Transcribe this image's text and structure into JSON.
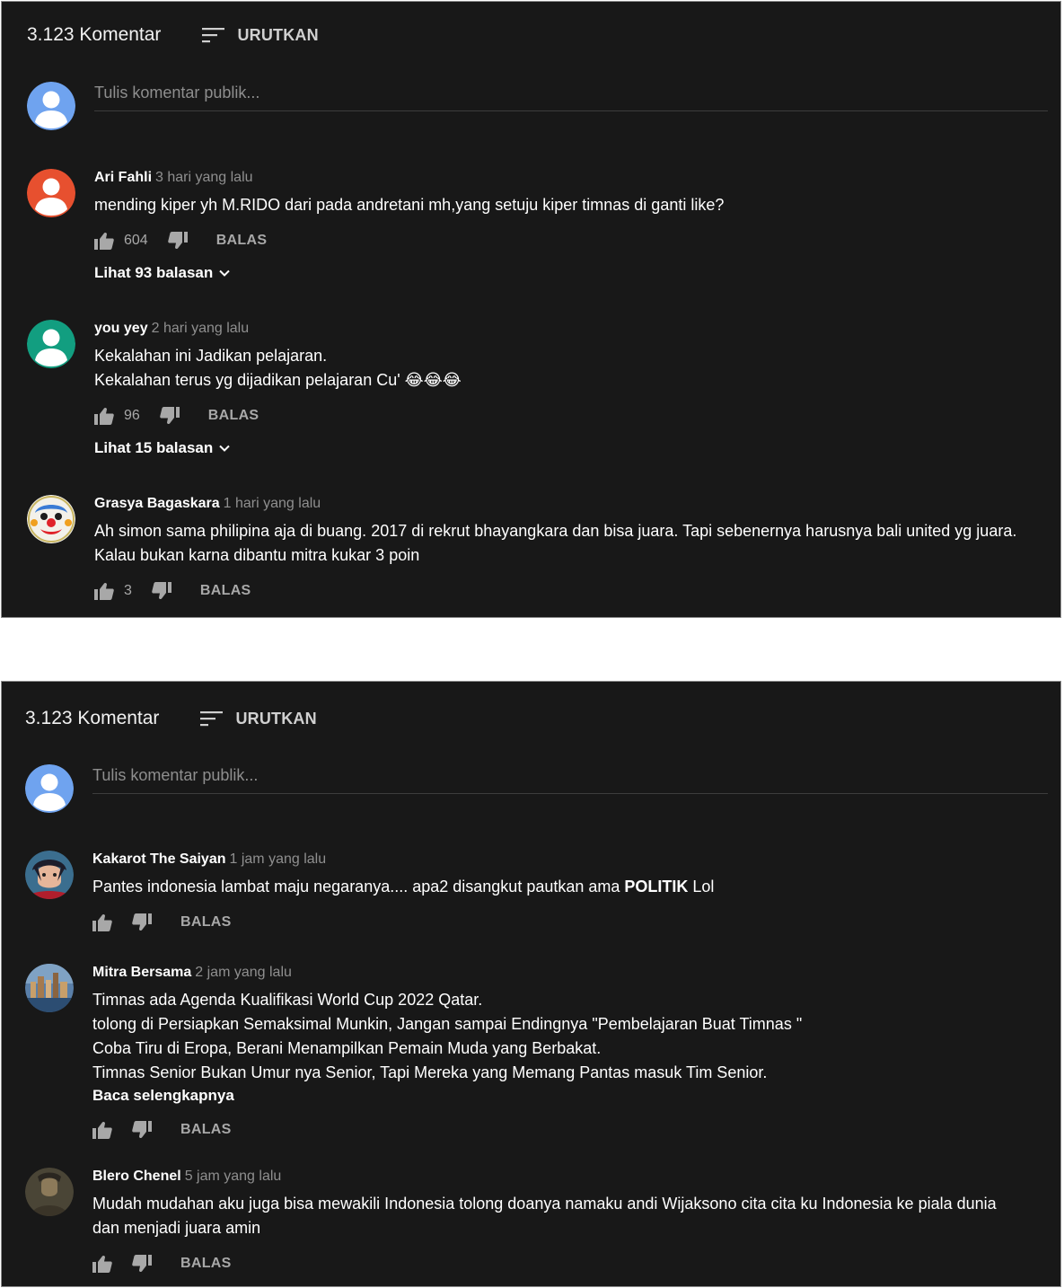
{
  "header": {
    "comment_count": "3.123 Komentar",
    "sort_label": "URUTKAN",
    "sort_icon": "sort-icon"
  },
  "compose": {
    "placeholder": "Tulis komentar publik..."
  },
  "panel1": {
    "comments": [
      {
        "author": "Ari Fahli",
        "time": "3 hari yang lalu",
        "lines": [
          "mending kiper yh M.RIDO dari pada andretani mh,yang setuju kiper timnas di ganti like?"
        ],
        "likes": "604",
        "reply_label": "BALAS",
        "replies_label": "Lihat 93 balasan",
        "avatar_color": "#e7502f"
      },
      {
        "author": "you yey",
        "time": "2 hari yang lalu",
        "lines": [
          "Kekalahan ini Jadikan pelajaran.",
          "Kekalahan terus yg dijadikan pelajaran Cu' 😂😂😂"
        ],
        "likes": "96",
        "reply_label": "BALAS",
        "replies_label": "Lihat 15 balasan",
        "avatar_color": "#129e80"
      },
      {
        "author": "Grasya Bagaskara",
        "time": "1 hari yang lalu",
        "lines": [
          "Ah simon sama philipina aja di buang. 2017 di rekrut bhayangkara dan bisa juara. Tapi sebenernya harusnya bali united yg juara.",
          "Kalau bukan karna dibantu mitra kukar 3 poin"
        ],
        "likes": "3",
        "reply_label": "BALAS"
      }
    ]
  },
  "panel2": {
    "comments": [
      {
        "author": "Kakarot The Saiyan",
        "time": "1 jam yang lalu",
        "text_prefix": "Pantes indonesia lambat maju negaranya.... apa2 disangkut pautkan ama ",
        "text_bold": "POLITIK",
        "text_suffix": " Lol",
        "reply_label": "BALAS"
      },
      {
        "author": "Mitra Bersama",
        "time": "2 jam yang lalu",
        "lines": [
          "Timnas ada Agenda Kualifikasi World Cup 2022 Qatar.",
          "tolong di Persiapkan Semaksimal Munkin, Jangan sampai Endingnya \"Pembelajaran Buat Timnas \"",
          "Coba Tiru di Eropa, Berani Menampilkan Pemain Muda yang Berbakat.",
          "Timnas Senior Bukan Umur nya Senior, Tapi Mereka yang Memang Pantas masuk Tim Senior."
        ],
        "read_more": "Baca selengkapnya",
        "reply_label": "BALAS"
      },
      {
        "author": "Blero Chenel",
        "time": "5 jam yang lalu",
        "lines": [
          "Mudah mudahan aku juga bisa mewakili Indonesia tolong doanya namaku andi Wijaksono cita cita ku Indonesia ke piala dunia",
          "dan menjadi juara amin"
        ],
        "reply_label": "BALAS"
      }
    ]
  },
  "colors": {
    "background": "#181818",
    "default_avatar": "#6fa3ef",
    "text": "#ffffff",
    "muted": "#8f8f8f"
  },
  "icons": [
    "sort-icon",
    "thumb-up-icon",
    "thumb-down-icon",
    "chevron-down-icon",
    "default-avatar-icon"
  ]
}
